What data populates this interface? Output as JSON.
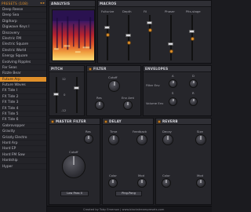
{
  "sidebar": {
    "title": "PRESETS (108)",
    "arrows": "◂ ▸",
    "presets": [
      "Deep Reese",
      "Deep Sea",
      "Digiharp",
      "Digiwave Keys I",
      "Discovery",
      "Electric FM",
      "Electric Square",
      "Electric World",
      "Energy Square",
      "Evolving Ripples",
      "Far Seas",
      "Fizzle Bear",
      "Future Arp",
      "Future Waves",
      "FX Tide I",
      "FX Tide 2",
      "FX Tide 3",
      "FX Tide 4",
      "FX Tide 5",
      "FX Tide 6",
      "Gabrovopper",
      "Gravity",
      "Grizzly Electro",
      "Hard Arp",
      "Hard EP",
      "Hard FM Saw",
      "Hardship",
      "Hyper"
    ],
    "selected_index": 12
  },
  "analysis": {
    "title": "ANALYSIS"
  },
  "macros": {
    "title": "MACROS",
    "labels": [
      "Fulturize",
      "Depth",
      "Fil",
      "Phaser",
      "Pits-stage"
    ],
    "levels": [
      0.75,
      0.55,
      0.85,
      0.35,
      0.65
    ]
  },
  "pitch": {
    "title": "PITCH",
    "scale": [
      "12",
      "0",
      "-12"
    ]
  },
  "filter": {
    "title": "FILTER",
    "knobs": [
      "Cutoff",
      "Res",
      "Env Amt"
    ]
  },
  "envelopes": {
    "title": "ENVELOPES",
    "row_labels": [
      "Filter Env",
      "Volume Env"
    ],
    "col_labels": [
      "A",
      "D",
      "S",
      "R"
    ]
  },
  "master_filter": {
    "title": "MASTER FILTER",
    "knobs": [
      "Res",
      "Cutoff"
    ],
    "button": "Low Pass II"
  },
  "delay": {
    "title": "DELAY",
    "knobs": [
      "Time",
      "Feedback",
      "Color",
      "Mod"
    ],
    "button": "Ping-Pong"
  },
  "reverb": {
    "title": "REVERB",
    "knobs": [
      "Decay",
      "Size",
      "Color",
      "Mod"
    ]
  },
  "footer": {
    "text": "Created by Toby Emerson | www.blackstreampresets.com"
  },
  "colors": {
    "accent": "#e0902a",
    "panel": "#26262b",
    "background": "#1b1b1f"
  }
}
